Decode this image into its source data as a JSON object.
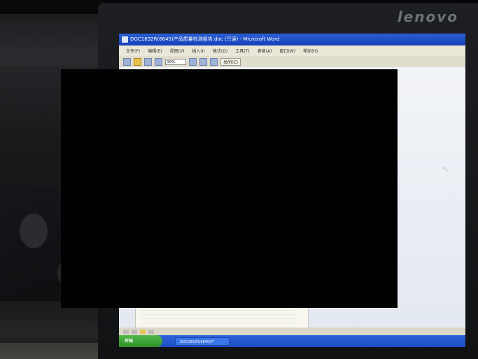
{
  "monitor": {
    "brand": "lenovo"
  },
  "window": {
    "title": "DOC1632R(6645)产品质量检测报告.doc (只读) - Microsoft Word",
    "menus": [
      "文件(F)",
      "编辑(E)",
      "视图(V)",
      "插入(I)",
      "格式(O)",
      "工具(T)",
      "表格(A)",
      "窗口(W)",
      "帮助(H)"
    ],
    "toolbar": {
      "zoom": "50%",
      "close_label": "关闭(C)"
    }
  },
  "taskbar": {
    "start_label": "开始",
    "task_label": "DOC1632R(6645)产"
  },
  "colors": {
    "redaction": "#000000",
    "titlebar": "#1f4fc8",
    "taskbar": "#2458d2",
    "start": "#3aa234"
  }
}
